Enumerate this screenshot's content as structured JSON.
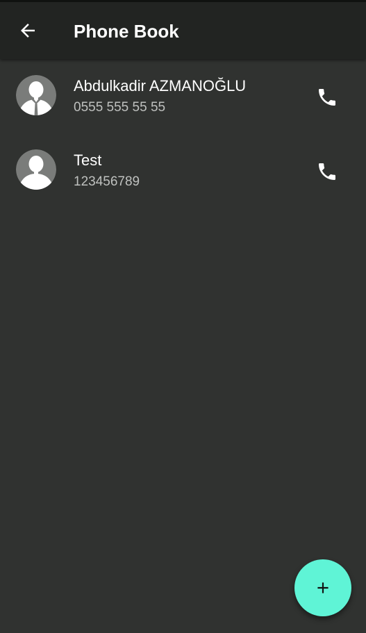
{
  "toolbar": {
    "title": "Phone Book",
    "back_icon": "arrow-left-icon"
  },
  "contacts": [
    {
      "name": "Abdulkadir AZMANOĞLU",
      "phone": "0555 555 55 55",
      "avatar_icon": "person-avatar-icon",
      "call_icon": "phone-icon"
    },
    {
      "name": "Test",
      "phone": "123456789",
      "avatar_icon": "person-avatar-icon",
      "call_icon": "phone-icon"
    }
  ],
  "fab": {
    "icon": "plus-icon",
    "color": "#5ff4d6"
  },
  "colors": {
    "background": "#303230",
    "toolbar": "#222422",
    "primary_text": "#ffffff",
    "secondary_text": "#bfc1bf",
    "accent": "#5ff4d6"
  }
}
